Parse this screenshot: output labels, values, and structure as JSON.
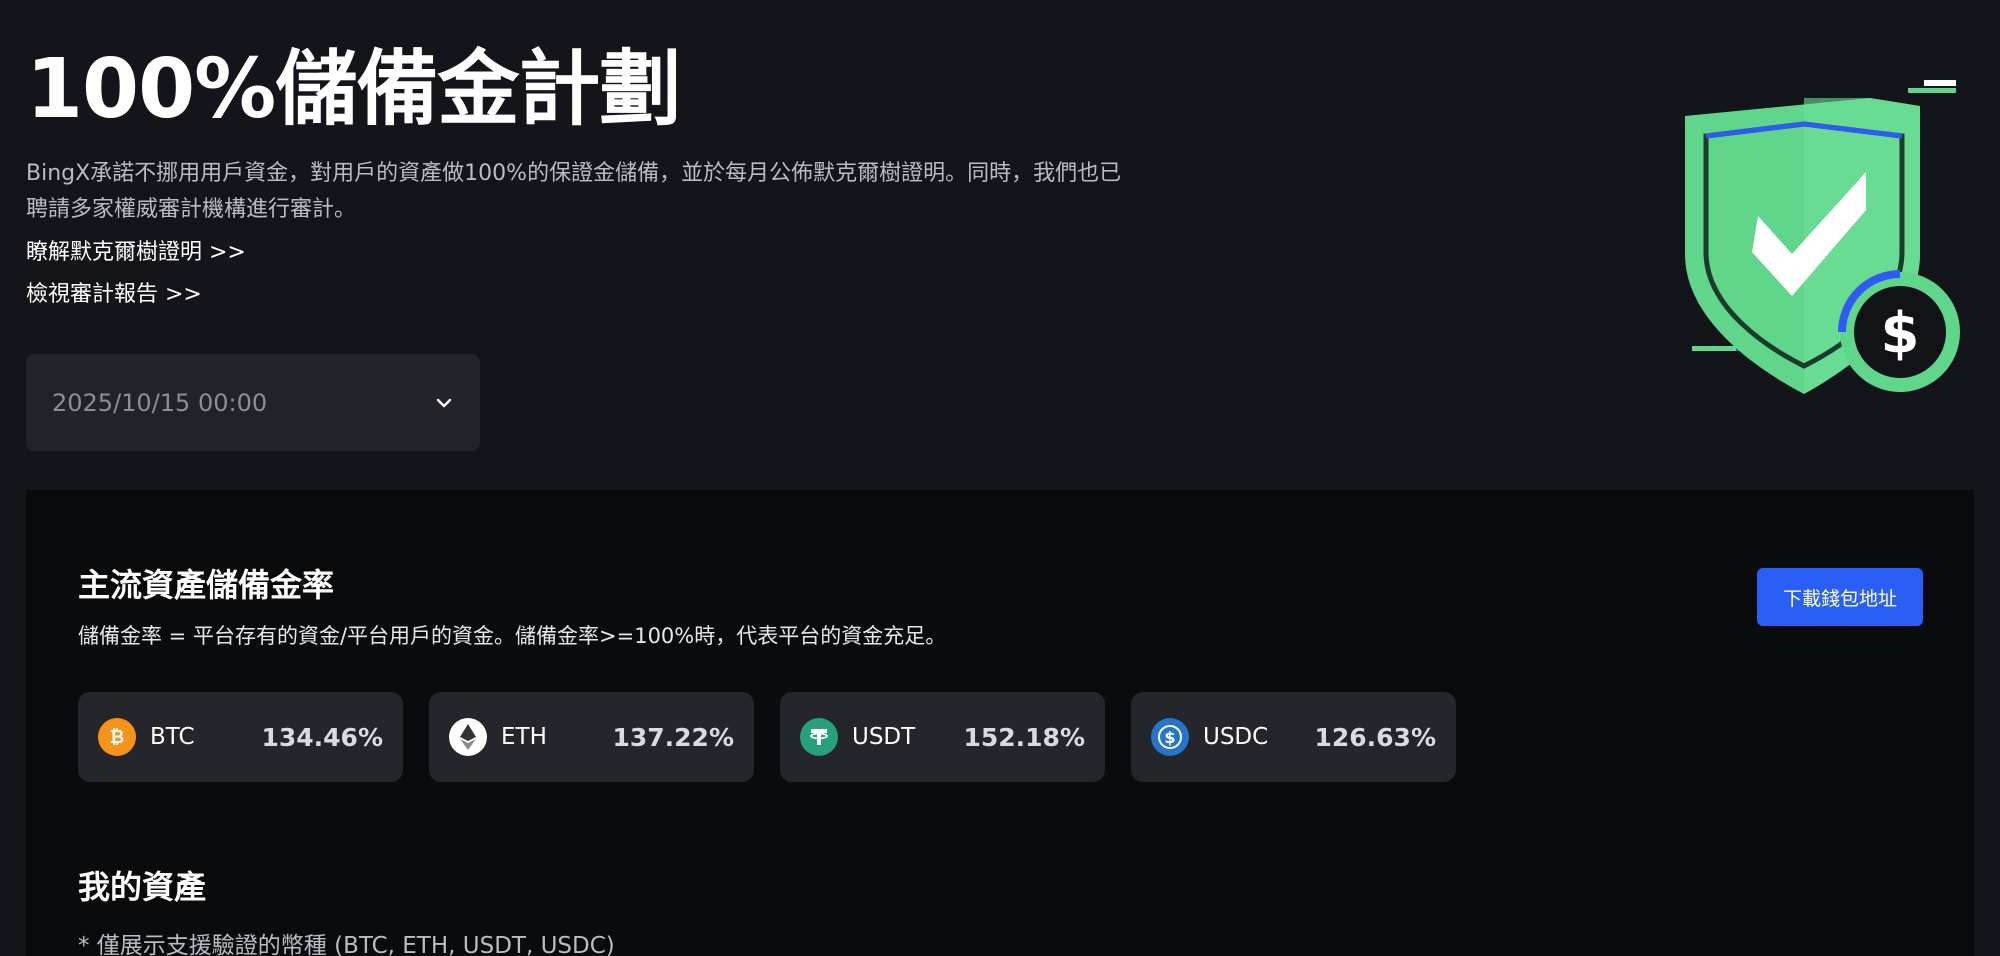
{
  "hero": {
    "title": "100%儲備金計劃",
    "description": "BingX承諾不挪用用戶資金，對用戶的資產做100%的保證金儲備，並於每月公佈默克爾樹證明。同時，我們也已聘請多家權威審計機構進行審計。",
    "merkle_link": "瞭解默克爾樹證明 >>",
    "audit_link": "檢視審計報告 >>"
  },
  "date_select": {
    "value": "2025/10/15 00:00",
    "icon": "chevron-down-icon"
  },
  "illustration": {
    "icon": "shield-check-dollar-icon",
    "colors": {
      "shield": "#5fd68a",
      "check": "#ffffff",
      "accent": "#2f5bf0",
      "coin": "#111316"
    }
  },
  "reserve": {
    "title": "主流資產儲備金率",
    "description": "儲備金率 = 平台存有的資金/平台用戶的資金。儲備金率>=100%時，代表平台的資金充足。",
    "download_button": "下載錢包地址",
    "assets": [
      {
        "symbol": "BTC",
        "ratio": "134.46%",
        "icon": "btc-icon",
        "color": "#f7931a"
      },
      {
        "symbol": "ETH",
        "ratio": "137.22%",
        "icon": "eth-icon",
        "color": "#ffffff"
      },
      {
        "symbol": "USDT",
        "ratio": "152.18%",
        "icon": "usdt-icon",
        "color": "#26a17b"
      },
      {
        "symbol": "USDC",
        "ratio": "126.63%",
        "icon": "usdc-icon",
        "color": "#2775ca"
      }
    ]
  },
  "my_assets": {
    "title": "我的資產",
    "note": "* 僅展示支援驗證的幣種 (BTC, ETH, USDT, USDC)"
  },
  "colors": {
    "background": "#14151a",
    "panel": "#0a0b0d",
    "card": "#24262c",
    "button": "#2a5ff5"
  }
}
